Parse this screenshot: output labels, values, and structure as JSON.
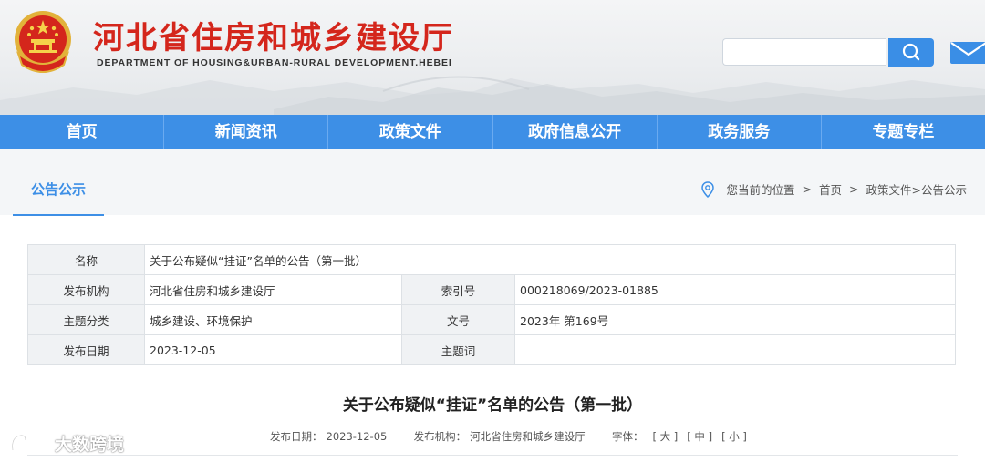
{
  "header": {
    "title": "河北省住房和城乡建设厅",
    "subtitle": "DEPARTMENT OF HOUSING&URBAN-RURAL DEVELOPMENT.HEBEI",
    "search_placeholder": "",
    "emblem_icon": "national-emblem-icon",
    "search_icon": "search-icon",
    "mail_icon": "mail-icon"
  },
  "nav": {
    "items": [
      "首页",
      "新闻资讯",
      "政策文件",
      "政府信息公开",
      "政务服务",
      "专题专栏"
    ]
  },
  "breadcrumb": {
    "section_title": "公告公示",
    "location_label": "您当前的位置",
    "sep": ">",
    "home": "首页",
    "path": "政策文件>公告公示"
  },
  "meta": {
    "name_label": "名称",
    "name_value": "关于公布疑似“挂证”名单的公告（第一批）",
    "org_label": "发布机构",
    "org_value": "河北省住房和城乡建设厅",
    "index_label": "索引号",
    "index_value": "000218069/2023-01885",
    "category_label": "主题分类",
    "category_value": "城乡建设、环境保护",
    "docno_label": "文号",
    "docno_value": "2023年 第169号",
    "date_label": "发布日期",
    "date_value": "2023-12-05",
    "keyword_label": "主题词",
    "keyword_value": ""
  },
  "article": {
    "title": "关于公布疑似“挂证”名单的公告（第一批）",
    "date_label": "发布日期：",
    "date_value": "2023-12-05",
    "org_label": "发布机构：",
    "org_value": "河北省住房和城乡建设厅",
    "font_label": "字体：",
    "font_large": "[ 大 ]",
    "font_medium": "[ 中 ]",
    "font_small": "[ 小 ]"
  },
  "watermark": {
    "text": "大数跨境"
  },
  "colors": {
    "brand_red": "#d4261c",
    "nav_blue": "#3d8fe6",
    "search_blue": "#3a8ee6"
  }
}
